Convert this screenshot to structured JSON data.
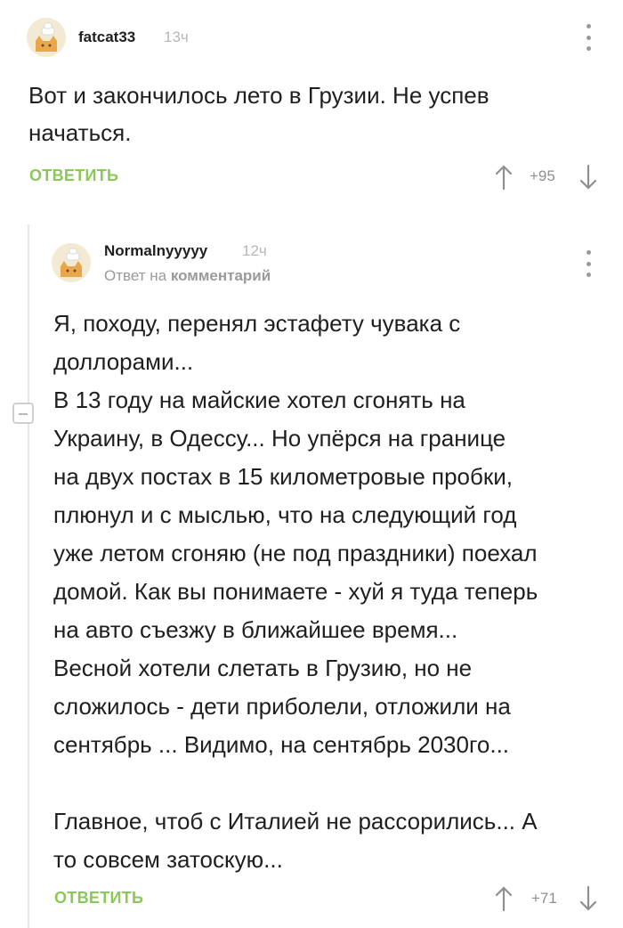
{
  "comments": [
    {
      "username": "fatcat33",
      "time": "13ч",
      "avatar_icon": "cat-avatar-icon",
      "text": "Вот и закончилось лето в Грузии. Не успев\nначаться.",
      "reply_label": "ОТВЕТИТЬ",
      "rating": "+95"
    },
    {
      "username": "Normalnyyyyy",
      "time": "12ч",
      "avatar_icon": "cat-avatar-icon",
      "reply_prefix": "Ответ на",
      "reply_target": "комментарий",
      "text": "Я, походу, перенял эстафету чувака с\nдоллорами...\nВ 13 году на майские хотел сгонять на\nУкраину, в Одессу... Но упёрся на границе\nна двух постах в 15 километровые пробки,\nплюнул и с мыслью, что на следующий год\nуже летом сгоняю (не под праздники) поехал\nдомой. Как вы понимаете - хуй я туда теперь\nна авто съезжу в ближайшее время...\nВесной хотели слетать в Грузию, но не\nсложилось - дети приболели, отложили на\nсентябрь ... Видимо, на сентябрь 2030го...\n\nГлавное, чтоб с Италией не рассорились... А\nто совсем затоскую...",
      "reply_label": "ОТВЕТИТЬ",
      "rating": "+71"
    }
  ],
  "colors": {
    "accent_green": "#8ac858",
    "muted_gray": "#9a9a9a",
    "text": "#1f1f1f"
  }
}
